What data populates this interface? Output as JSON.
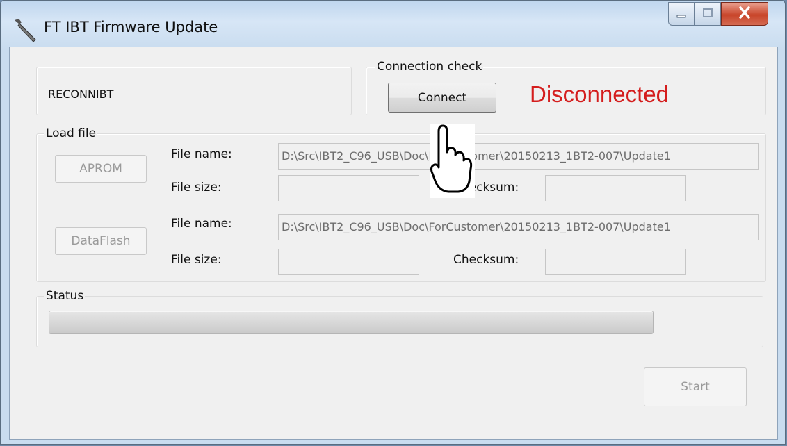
{
  "window": {
    "title": "FT IBT Firmware Update"
  },
  "device_group": {
    "device_name": "RECONNIBT"
  },
  "connection": {
    "group_label": "Connection check",
    "connect_button": "Connect",
    "status_text": "Disconnected",
    "status_color": "#d41d1d"
  },
  "load_file": {
    "group_label": "Load file",
    "aprom": {
      "button": "APROM",
      "file_name_label": "File name:",
      "file_name_value": "D:\\Src\\IBT2_C96_USB\\Doc\\ForCustomer\\20150213_1BT2-007\\Update1",
      "file_size_label": "File size:",
      "file_size_value": "",
      "checksum_label": "Checksum:",
      "checksum_value": ""
    },
    "dataflash": {
      "button": "DataFlash",
      "file_name_label": "File name:",
      "file_name_value": "D:\\Src\\IBT2_C96_USB\\Doc\\ForCustomer\\20150213_1BT2-007\\Update1",
      "file_size_label": "File size:",
      "file_size_value": "",
      "checksum_label": "Checksum:",
      "checksum_value": ""
    }
  },
  "status": {
    "group_label": "Status",
    "progress": 0
  },
  "actions": {
    "start_button": "Start"
  },
  "icons": {
    "app": "wrench-icon",
    "minimize": "minimize-icon",
    "maximize": "maximize-icon",
    "close": "close-icon",
    "cursor": "hand-pointer-icon"
  }
}
